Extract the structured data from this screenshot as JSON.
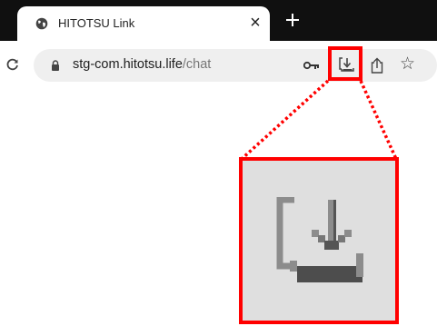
{
  "tab": {
    "title": "HITOTSU Link",
    "close_glyph": "×"
  },
  "omnibox": {
    "url_host": "stg-com.hitotsu.life",
    "url_path": "/chat"
  },
  "toolbar": {
    "star_glyph": "☆"
  },
  "icons": {
    "tab_favicon": "globe-icon",
    "new_tab": "plus-icon",
    "reload": "reload-icon",
    "security": "lock-icon",
    "passwords": "key-icon",
    "install_app": "install-app-icon",
    "share": "share-icon",
    "bookmark": "star-icon"
  },
  "colors": {
    "highlight": "#ff0000",
    "tabstrip": "#101010",
    "omnibox": "#efefef",
    "zoom_background": "#dfdfdf"
  }
}
